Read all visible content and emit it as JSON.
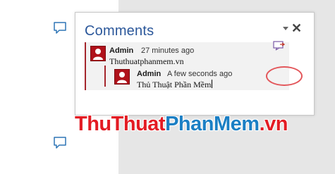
{
  "panel": {
    "title": "Comments",
    "close_glyph": "✕",
    "dropdown_icon": "triangle-down-icon"
  },
  "comments": [
    {
      "author": "Admin",
      "time": "27 minutes ago",
      "text": "Thuthuatphanmem.vn",
      "avatar_color": "#b0121b"
    }
  ],
  "replies": [
    {
      "author": "Admin",
      "time": "A few seconds ago",
      "text": "Thủ Thuật Phần Mềm",
      "avatar_color": "#b0121b"
    }
  ],
  "watermark": {
    "part1": "ThuThuat",
    "part2": "PhanMem",
    "part3": ".vn"
  },
  "colors": {
    "title_blue": "#2b579a",
    "comment_bar": "#a4262c",
    "highlight_oval": "#e3575b",
    "watermark_red": "#e31b23",
    "watermark_blue": "#1b7fc4"
  },
  "icons": {
    "margin_comment": "comment-bubble-icon",
    "reply": "reply-comment-icon",
    "avatar": "user-avatar-icon"
  }
}
